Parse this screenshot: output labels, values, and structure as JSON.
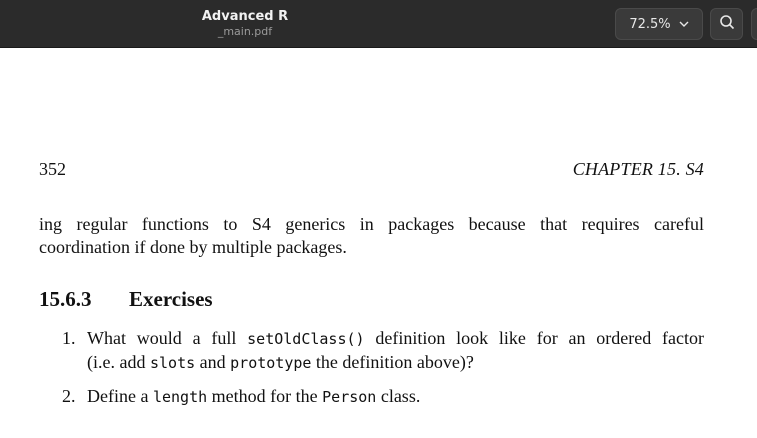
{
  "window": {
    "app_title": "Advanced R",
    "file_name": "_main.pdf"
  },
  "toolbar": {
    "zoom_level": "72.5%",
    "zoom_icon": "chevron-down-icon",
    "search_icon": "search-icon"
  },
  "page": {
    "page_number": "352",
    "running_head": "CHAPTER 15.  S4",
    "paragraph_lines": [
      "ing regular functions to S4 generics in packages because that requires careful",
      "coordination if done by multiple packages."
    ],
    "section": {
      "number": "15.6.3",
      "title": "Exercises"
    },
    "exercises": [
      {
        "marker": "1.",
        "line1_pre": "What would a full ",
        "line1_code": "setOldClass()",
        "line1_post": " definition look like for an ordered factor",
        "line2_pre": "(i.e. add ",
        "line2_code1": "slots",
        "line2_mid": " and ",
        "line2_code2": "prototype",
        "line2_post": " the definition above)?"
      },
      {
        "marker": "2.",
        "pre": "Define a ",
        "code1": "length",
        "mid": " method for the ",
        "code2": "Person",
        "post": " class."
      }
    ]
  },
  "colors": {
    "titlebar": "#2b2b2b",
    "page": "#ffffff",
    "text": "#111111"
  }
}
